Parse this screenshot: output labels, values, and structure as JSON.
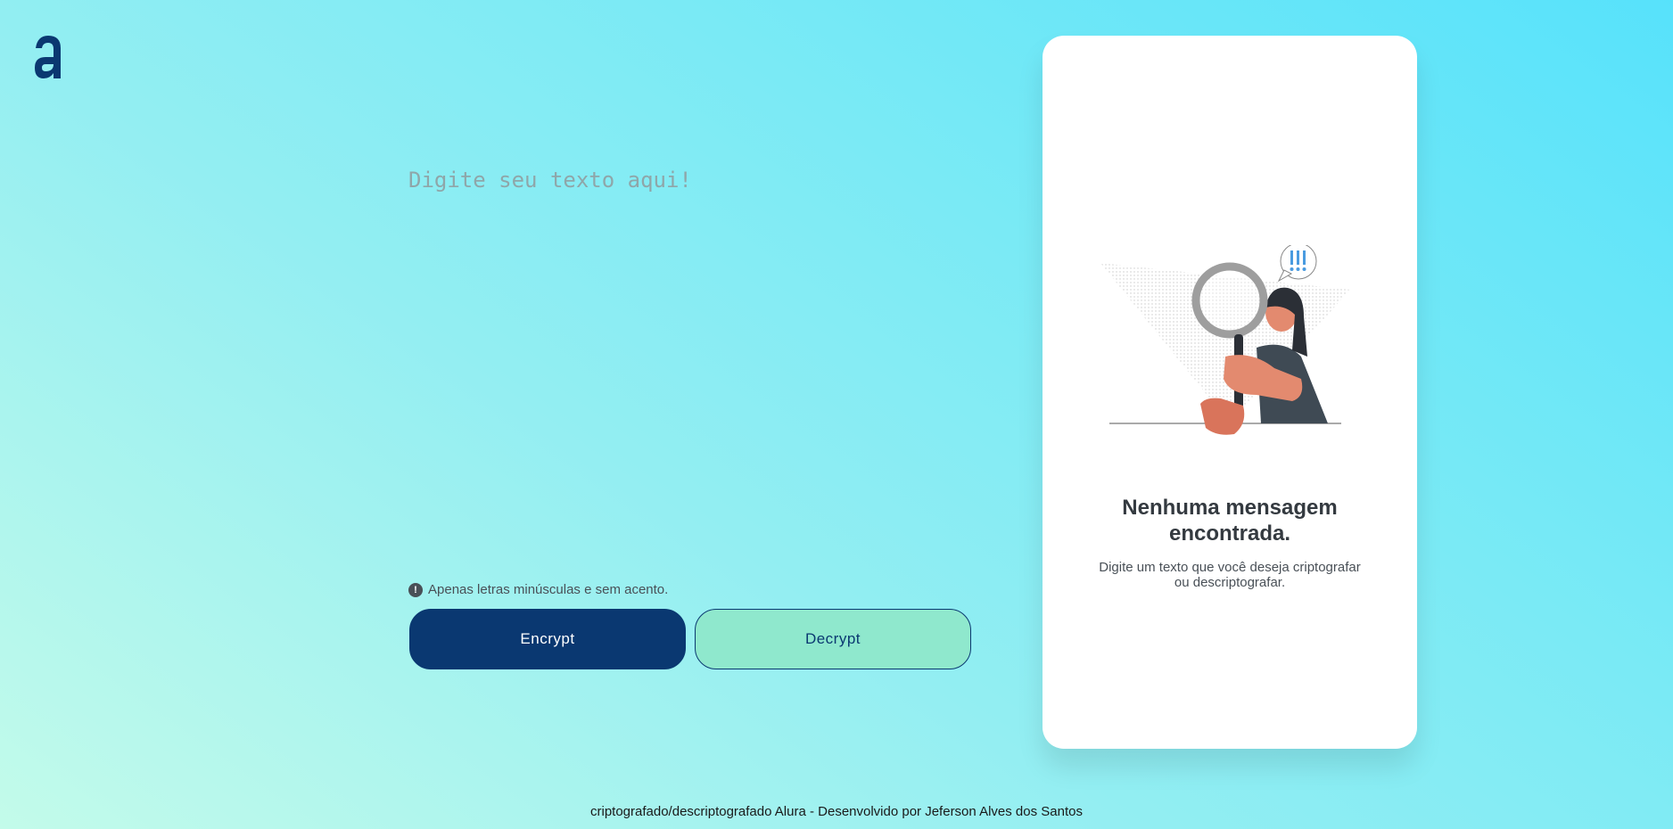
{
  "logo": {
    "icon": "alura-logo-icon"
  },
  "editor": {
    "placeholder": "Digite seu texto aqui!",
    "value": ""
  },
  "hint": {
    "icon": "exclamation-icon",
    "text": "Apenas letras minúsculas e sem acento."
  },
  "actions": {
    "encrypt_label": "Encrypt",
    "decrypt_label": "Decrypt"
  },
  "result": {
    "illustration": "woman-magnifying-glass-illustration",
    "title": "Nenhuma mensagem encontrada.",
    "subtitle": "Digite um texto que você deseja criptografar ou descriptografar."
  },
  "footer": {
    "text": "criptografado/descriptografado Alura - Desenvolvido por Jeferson Alves dos Santos"
  },
  "colors": {
    "primary": "#0a3871",
    "secondary": "#8fe8cd",
    "card": "#ffffff"
  }
}
